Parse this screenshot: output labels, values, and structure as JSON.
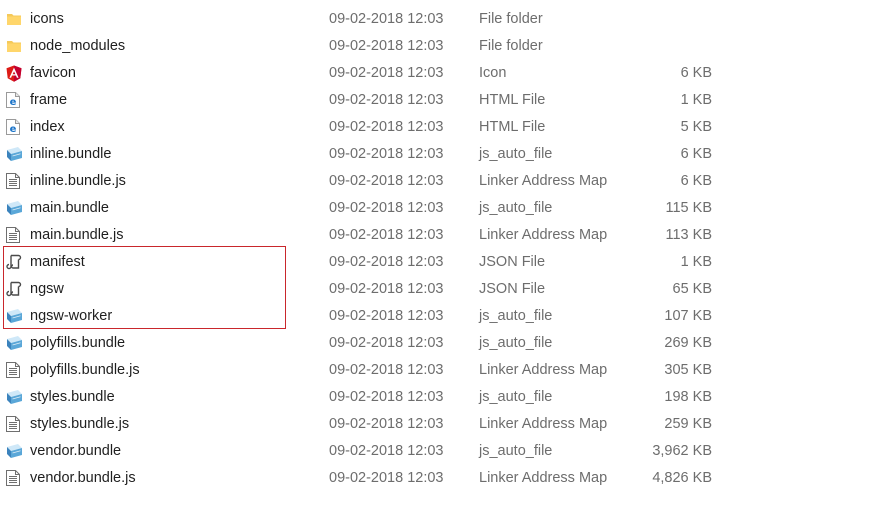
{
  "files": [
    {
      "name": "icons",
      "date": "09-02-2018 12:03",
      "type": "File folder",
      "size": "",
      "icon": "folder-icon"
    },
    {
      "name": "node_modules",
      "date": "09-02-2018 12:03",
      "type": "File folder",
      "size": "",
      "icon": "folder-icon"
    },
    {
      "name": "favicon",
      "date": "09-02-2018 12:03",
      "type": "Icon",
      "size": "6 KB",
      "icon": "angular-icon"
    },
    {
      "name": "frame",
      "date": "09-02-2018 12:03",
      "type": "HTML File",
      "size": "1 KB",
      "icon": "edge-html-icon"
    },
    {
      "name": "index",
      "date": "09-02-2018 12:03",
      "type": "HTML File",
      "size": "5 KB",
      "icon": "edge-html-icon"
    },
    {
      "name": "inline.bundle",
      "date": "09-02-2018 12:03",
      "type": "js_auto_file",
      "size": "6 KB",
      "icon": "bundle-file-icon"
    },
    {
      "name": "inline.bundle.js",
      "date": "09-02-2018 12:03",
      "type": "Linker Address Map",
      "size": "6 KB",
      "icon": "text-document-icon"
    },
    {
      "name": "main.bundle",
      "date": "09-02-2018 12:03",
      "type": "js_auto_file",
      "size": "115 KB",
      "icon": "bundle-file-icon"
    },
    {
      "name": "main.bundle.js",
      "date": "09-02-2018 12:03",
      "type": "Linker Address Map",
      "size": "113 KB",
      "icon": "text-document-icon"
    },
    {
      "name": "manifest",
      "date": "09-02-2018 12:03",
      "type": "JSON File",
      "size": "1 KB",
      "icon": "json-file-icon"
    },
    {
      "name": "ngsw",
      "date": "09-02-2018 12:03",
      "type": "JSON File",
      "size": "65 KB",
      "icon": "json-file-icon"
    },
    {
      "name": "ngsw-worker",
      "date": "09-02-2018 12:03",
      "type": "js_auto_file",
      "size": "107 KB",
      "icon": "bundle-file-icon"
    },
    {
      "name": "polyfills.bundle",
      "date": "09-02-2018 12:03",
      "type": "js_auto_file",
      "size": "269 KB",
      "icon": "bundle-file-icon"
    },
    {
      "name": "polyfills.bundle.js",
      "date": "09-02-2018 12:03",
      "type": "Linker Address Map",
      "size": "305 KB",
      "icon": "text-document-icon"
    },
    {
      "name": "styles.bundle",
      "date": "09-02-2018 12:03",
      "type": "js_auto_file",
      "size": "198 KB",
      "icon": "bundle-file-icon"
    },
    {
      "name": "styles.bundle.js",
      "date": "09-02-2018 12:03",
      "type": "Linker Address Map",
      "size": "259 KB",
      "icon": "text-document-icon"
    },
    {
      "name": "vendor.bundle",
      "date": "09-02-2018 12:03",
      "type": "js_auto_file",
      "size": "3,962 KB",
      "icon": "bundle-file-icon"
    },
    {
      "name": "vendor.bundle.js",
      "date": "09-02-2018 12:03",
      "type": "Linker Address Map",
      "size": "4,826 KB",
      "icon": "text-document-icon"
    }
  ],
  "highlight": {
    "color": "#c9272c",
    "rows": [
      "manifest",
      "ngsw",
      "ngsw-worker"
    ]
  },
  "colors": {
    "folder": "#f5c95a",
    "angular": "#dd1b16",
    "edge": "#1a73c8",
    "bundle": "#5aa7d8"
  }
}
